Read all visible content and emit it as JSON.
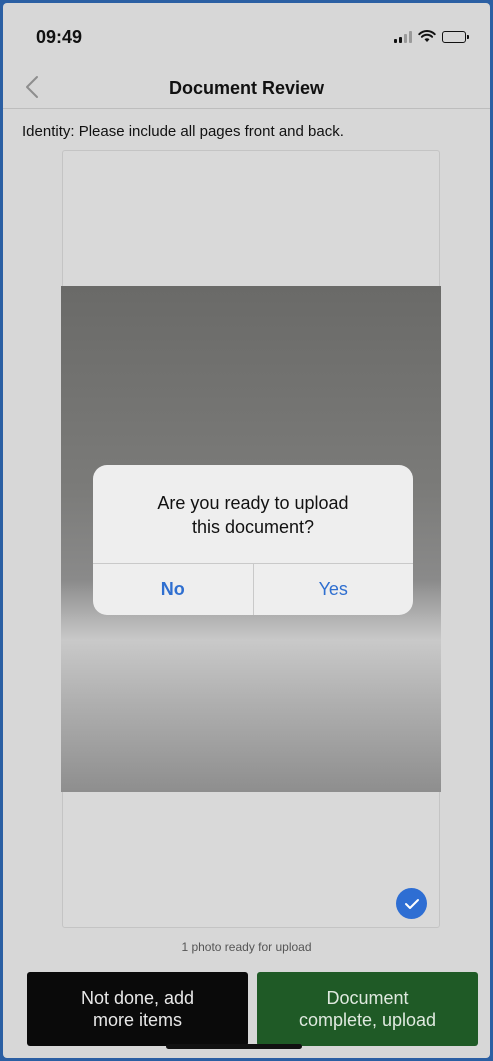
{
  "status_bar": {
    "time": "09:49"
  },
  "nav": {
    "title": "Document Review",
    "back_icon": "chevron-left-icon"
  },
  "instruction": "Identity: Please include all pages front and back.",
  "document": {
    "photo_count_text": "1 photo ready for upload",
    "selected_icon": "checkmark-icon"
  },
  "dialog": {
    "message": "Are you ready to upload\nthis document?",
    "no_label": "No",
    "yes_label": "Yes"
  },
  "actions": {
    "not_done_label": "Not done, add\nmore items",
    "complete_label": "Document\ncomplete, upload"
  },
  "colors": {
    "accent": "#2F6FD0",
    "complete_button": "#1F5A26",
    "not_done_button": "#0A0A0A"
  }
}
